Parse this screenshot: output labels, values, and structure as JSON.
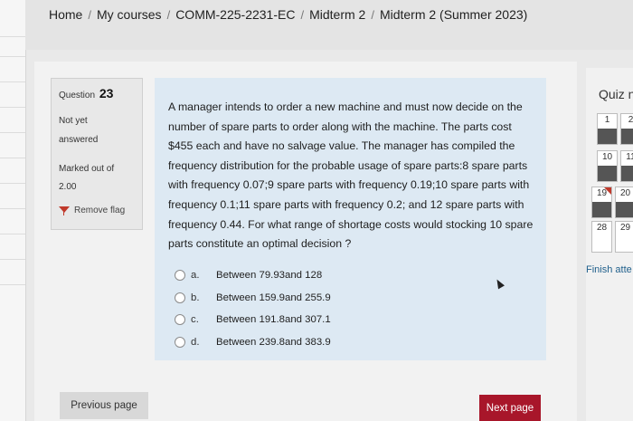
{
  "breadcrumb": [
    "Home",
    "My courses",
    "COMM-225-2231-EC",
    "Midterm 2",
    "Midterm 2 (Summer 2023)"
  ],
  "question_info": {
    "label": "Question",
    "number": "23",
    "status_line1": "Not yet",
    "status_line2": "answered",
    "marked_line1": "Marked out of",
    "marked_value": "2.00",
    "flag_label": "Remove flag"
  },
  "question": {
    "text": "A manager intends to order a new machine and must now decide on the number of spare parts to order along with the machine. The parts cost $455 each and have no salvage value. The manager has compiled the frequency distribution for the probable usage of spare parts:8 spare parts with frequency 0.07;9 spare parts with frequency 0.19;10 spare parts with frequency 0.1;11 spare parts with frequency 0.2; and 12 spare parts with frequency 0.44. For what range of shortage costs would stocking 10 spare parts constitute an optimal decision ?",
    "options": [
      {
        "letter": "a.",
        "text": "Between 79.93and 128"
      },
      {
        "letter": "b.",
        "text": "Between 159.9and 255.9"
      },
      {
        "letter": "c.",
        "text": "Between 191.8and 307.1"
      },
      {
        "letter": "d.",
        "text": "Between 239.8and 383.9"
      }
    ]
  },
  "buttons": {
    "previous": "Previous page",
    "next": "Next page"
  },
  "quiz_nav": {
    "title": "Quiz n",
    "items": [
      {
        "num": "1",
        "answered": true,
        "flagged": false
      },
      {
        "num": "2",
        "answered": true,
        "flagged": false
      },
      {
        "num": "10",
        "answered": true,
        "flagged": false
      },
      {
        "num": "11",
        "answered": true,
        "flagged": false
      },
      {
        "num": "19",
        "answered": true,
        "flagged": true
      },
      {
        "num": "20",
        "answered": true,
        "flagged": false
      },
      {
        "num": "28",
        "answered": false,
        "flagged": false
      },
      {
        "num": "29",
        "answered": false,
        "flagged": false
      }
    ],
    "finish_label": "Finish atte"
  },
  "colors": {
    "next_button": "#a8162a",
    "question_panel": "#dde9f3",
    "flag": "#c0392b",
    "link": "#1f5f8b"
  },
  "icons": [
    "flag-icon",
    "radio-unchecked-icon",
    "mouse-cursor-icon"
  ]
}
